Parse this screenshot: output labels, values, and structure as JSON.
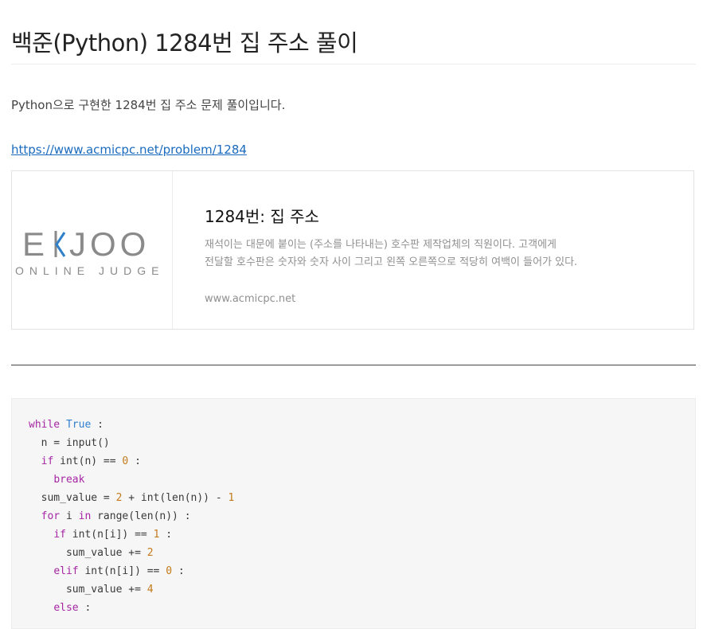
{
  "post": {
    "title": "백준(Python) 1284번 집 주소 풀이",
    "intro": "Python으로 구현한 1284번 집 주소 문제 풀이입니다.",
    "link_text": "https://www.acmicpc.net/problem/1284"
  },
  "link_card": {
    "logo_wordmark": "BAEKJOON",
    "logo_visible_text": "EKJOO",
    "logo_tagline": "ONLINE JUDGE",
    "title": "1284번: 집 주소",
    "description": "재석이는 대문에 붙이는 (주소를 나타내는) 호수판 제작업체의 직원이다. 고객에게 전달할 호수판은 숫자와 숫자 사이 그리고 왼쪽 오른쪽으로 적당히 여백이 들어가 있다.",
    "host": "www.acmicpc.net"
  },
  "code": {
    "language": "python",
    "lines": [
      "while True :",
      "  n = input()",
      "  if int(n) == 0 :",
      "    break",
      "  sum_value = 2 + int(len(n)) - 1",
      "  for i in range(len(n)) :",
      "    if int(n[i]) == 1 :",
      "      sum_value += 2",
      "    elif int(n[i]) == 0 :",
      "      sum_value += 4",
      "    else :"
    ]
  },
  "colors": {
    "link": "#1a6bbf",
    "keyword": "#a626a4",
    "builtin": "#2f7fd0",
    "number": "#c27a1b",
    "logo_accent": "#2f80c8",
    "logo_gray": "#8a8a8a"
  }
}
